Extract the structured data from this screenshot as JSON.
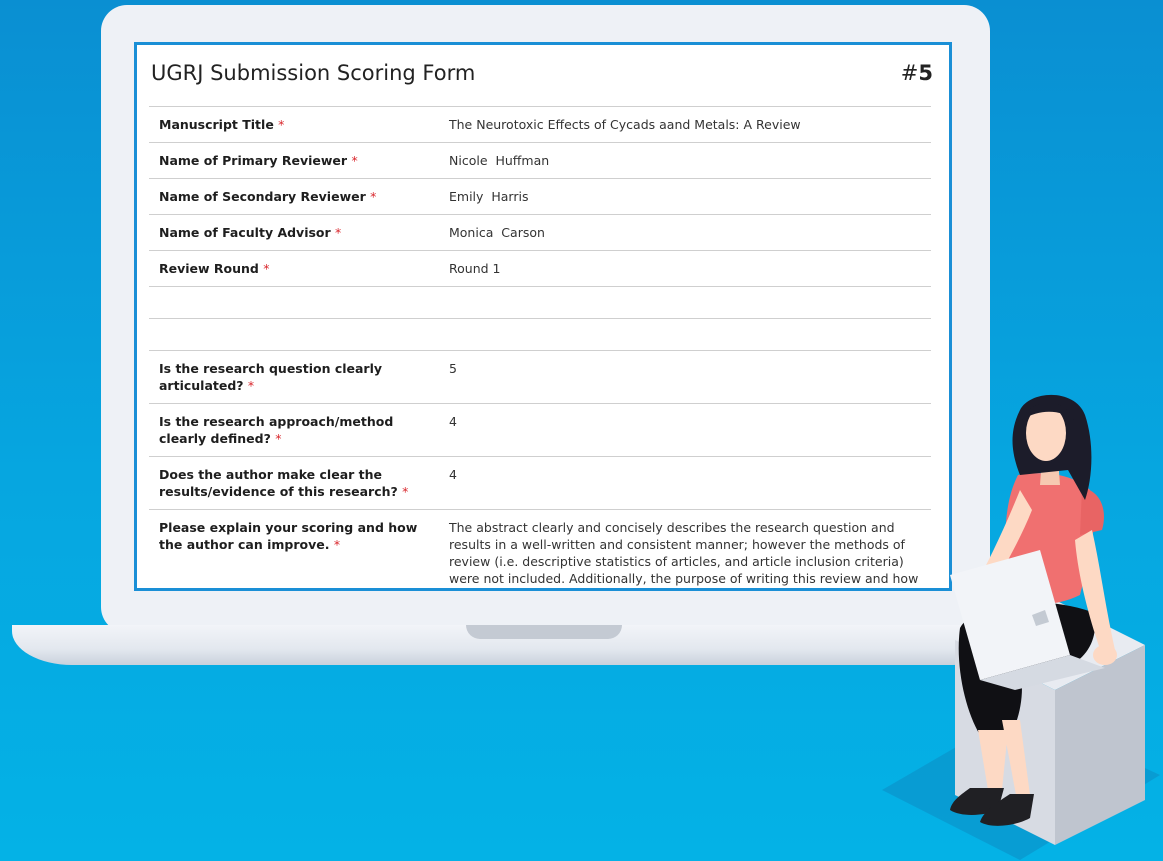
{
  "form": {
    "title": "UGRJ Submission Scoring Form",
    "number_prefix": "#",
    "number": "5",
    "required_marker": "*"
  },
  "fields": [
    {
      "label": "Manuscript Title",
      "value": "The Neurotoxic Effects of Cycads aand Metals: A Review"
    },
    {
      "label": "Name of Primary Reviewer",
      "value": "Nicole  Huffman"
    },
    {
      "label": "Name of Secondary Reviewer",
      "value": "Emily  Harris"
    },
    {
      "label": "Name of Faculty Advisor",
      "value": "Monica  Carson"
    },
    {
      "label": "Review Round",
      "value": "Round 1"
    },
    {
      "label": "Is the research question clearly articulated?",
      "value": "5"
    },
    {
      "label": "Is the research approach/method clearly defined?",
      "value": "4"
    },
    {
      "label": "Does the author make clear the results/evidence of this research?",
      "value": "4"
    },
    {
      "label": "Please explain your scoring and how the author can improve.",
      "value": "The abstract clearly and concisely describes the research question and results in a well-written and consistent manner; however the methods of review (i.e. descriptive statistics of articles, and article inclusion criteria) were not included. Additionally, the purpose of writing this review and how will benefit this area of research could be more developed."
    }
  ],
  "colors": {
    "background_top": "#0a8fd2",
    "background_bottom": "#04b2e6",
    "screen_border": "#1a8fd6",
    "required": "#d9262c",
    "shirt": "#f07070",
    "hair": "#1c1c2a",
    "skin": "#fdd9c4"
  }
}
